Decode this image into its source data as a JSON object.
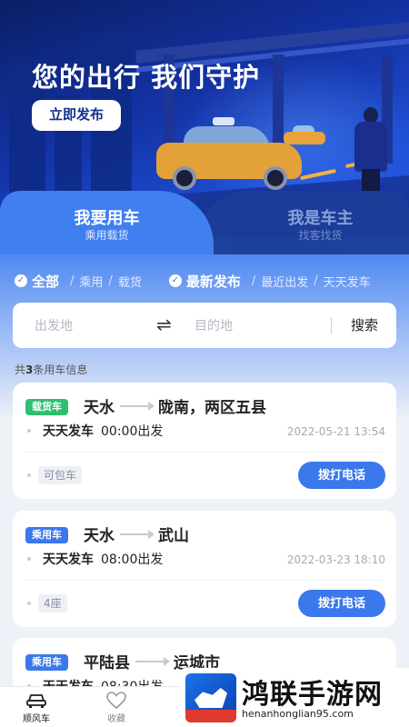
{
  "hero": {
    "title": "您的出行 我们守护",
    "cta_label": "立即发布"
  },
  "tabs": [
    {
      "title": "我要用车",
      "subtitle": "乘用载货",
      "active": true
    },
    {
      "title": "我是车主",
      "subtitle": "找客找货",
      "active": false
    }
  ],
  "filters": {
    "group1": {
      "selected": "全部",
      "options": [
        "乘用",
        "载货"
      ]
    },
    "group2": {
      "selected": "最新发布",
      "options": [
        "最近出发",
        "天天发车"
      ]
    }
  },
  "search": {
    "from_placeholder": "出发地",
    "swap_icon": "⇌",
    "to_placeholder": "目的地",
    "button_label": "搜索"
  },
  "summary": {
    "prefix": "共",
    "count": "3",
    "suffix": "条用车信息"
  },
  "listings": [
    {
      "badge": "载货车",
      "badge_color": "#2fbf71",
      "from": "天水",
      "to": "陇南，两区五县",
      "frequency": "天天发车",
      "time": "00:00出发",
      "date": "2022-05-21 13:54",
      "tag": "可包车",
      "call_label": "拨打电话"
    },
    {
      "badge": "乘用车",
      "badge_color": "#3a78ec",
      "from": "天水",
      "to": "武山",
      "frequency": "天天发车",
      "time": "08:00出发",
      "date": "2022-03-23 18:10",
      "tag": "4座",
      "call_label": "拨打电话"
    },
    {
      "badge": "乘用车",
      "badge_color": "#3a78ec",
      "from": "平陆县",
      "to": "运城市",
      "frequency": "天天发车",
      "time": "08:30出发",
      "date": "",
      "tag": "",
      "call_label": ""
    }
  ],
  "bottom_nav": [
    {
      "label": "顺风车",
      "icon": "car-icon",
      "active": true
    },
    {
      "label": "收藏",
      "icon": "heart-icon",
      "active": false
    }
  ],
  "watermark": {
    "title": "鸿联手游网",
    "url": "henanhonglian95.com"
  }
}
